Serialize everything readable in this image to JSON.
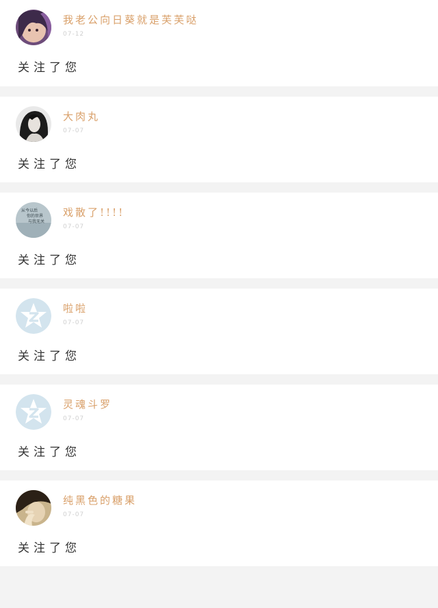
{
  "feed": {
    "items": [
      {
        "name": "我老公向日葵就是芙芙哒",
        "date": "07-12",
        "action": "关注了您",
        "avatar": "avatar-purple-hair"
      },
      {
        "name": "大肉丸",
        "date": "07-07",
        "action": "关注了您",
        "avatar": "avatar-dark-hair"
      },
      {
        "name": "戏散了!!!!",
        "date": "07-07",
        "action": "关注了您",
        "avatar": "avatar-text-image",
        "avatar_text": "从今以后 你的世界 与我无关"
      },
      {
        "name": "啦啦",
        "date": "07-07",
        "action": "关注了您",
        "avatar": "avatar-default-qzone"
      },
      {
        "name": "灵魂斗罗",
        "date": "07-07",
        "action": "关注了您",
        "avatar": "avatar-default-qzone"
      },
      {
        "name": "纯黑色的糖果",
        "date": "07-07",
        "action": "关注了您",
        "avatar": "avatar-hand-portrait"
      }
    ]
  }
}
